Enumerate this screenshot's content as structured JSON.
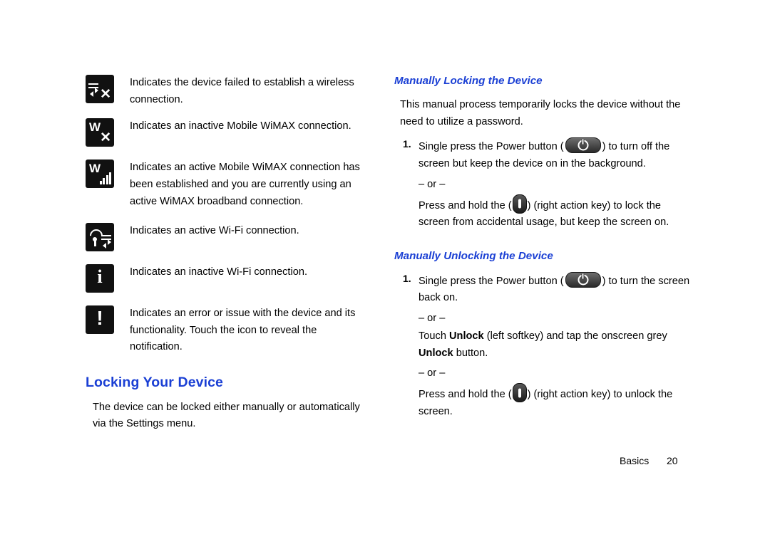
{
  "left_column": {
    "icon_rows": [
      {
        "icon": "wimax-failed-connection-icon",
        "text": "Indicates the device failed to establish a wireless connection."
      },
      {
        "icon": "wimax-inactive-icon",
        "text": "Indicates an inactive Mobile WiMAX connection."
      },
      {
        "icon": "wimax-active-icon",
        "text": "Indicates an active Mobile WiMAX connection has been established and you are currently using an active WiMAX broadband connection."
      },
      {
        "icon": "wifi-active-icon",
        "text": "Indicates an active Wi-Fi connection."
      },
      {
        "icon": "wifi-inactive-icon",
        "text": "Indicates an inactive Wi-Fi connection."
      },
      {
        "icon": "error-notification-icon",
        "text": "Indicates an error or issue with the device and its functionality. Touch the icon to reveal the notification."
      }
    ],
    "section_heading": "Locking Your Device",
    "section_paragraph": "The device can be locked either manually or automatically via the Settings menu."
  },
  "right_column": {
    "lock_heading": "Manually Locking the Device",
    "lock_intro": "This manual process temporarily locks the device without the need to utilize a password.",
    "lock_step_number": "1.",
    "lock_step_part1": "Single press the Power button (",
    "lock_step_part2": ") to turn off the screen but keep the device on in the background.",
    "lock_or": "– or –",
    "lock_alt_part1": "Press and hold the (",
    "lock_alt_part2": ") (right action key) to lock the screen from accidental usage, but keep the screen on.",
    "unlock_heading": "Manually Unlocking the Device",
    "unlock_step_number": "1.",
    "unlock_step_part1": "Single press the Power button (",
    "unlock_step_part2": ") to turn the screen back on.",
    "unlock_or_1": "– or –",
    "unlock_touch_pre": "Touch ",
    "unlock_touch_bold": "Unlock",
    "unlock_touch_mid": " (left softkey) and tap the onscreen grey ",
    "unlock_touch_bold2": "Unlock",
    "unlock_touch_end": " button.",
    "unlock_or_2": "– or –",
    "unlock_alt_part1": "Press and hold the (",
    "unlock_alt_part2": ") (right action key) to unlock the screen."
  },
  "footer": {
    "label": "Basics",
    "page_number": "20"
  },
  "colors": {
    "heading_blue": "#1a3fd4",
    "icon_black": "#111111",
    "text_black": "#000000"
  }
}
